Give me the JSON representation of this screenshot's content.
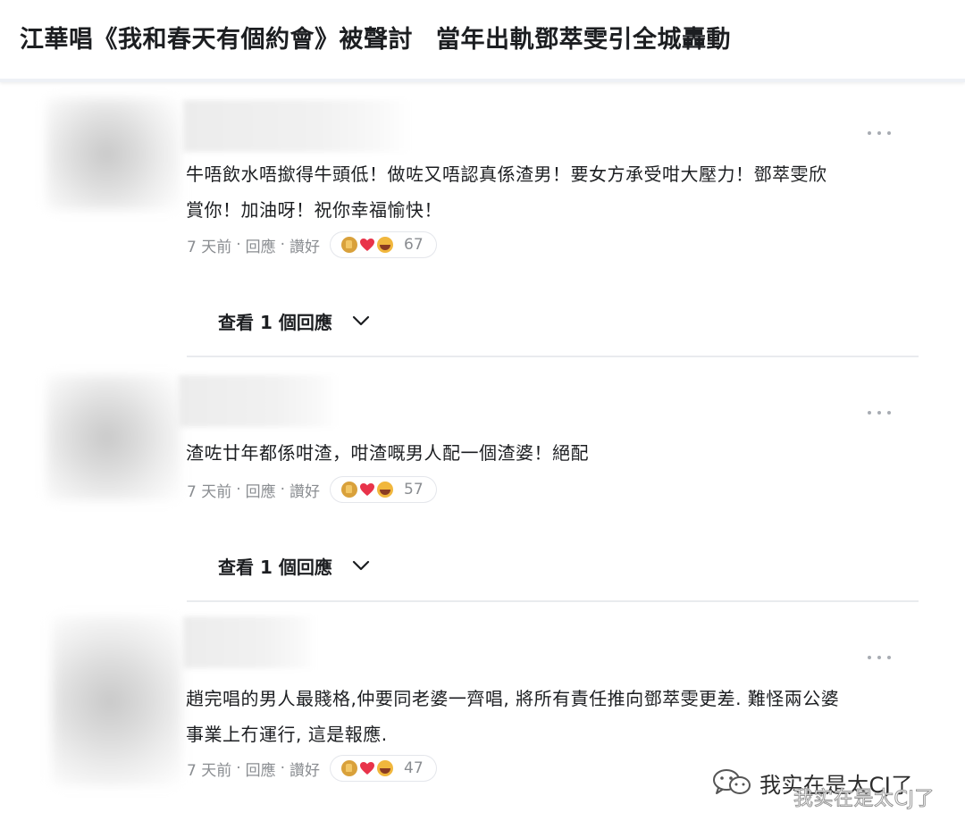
{
  "header": {
    "title_part1": "江華唱《我和春天有個約會》被聲討",
    "title_part2": "當年出軌鄧萃雯引全城轟動"
  },
  "comments": [
    {
      "body_line1": "牛唔飲水唔撳得牛頭低！做咗又唔認真係渣男！要女方承受咁大壓力！鄧萃雯欣",
      "body_line2": "賞你！加油呀！祝你幸福愉快！",
      "time": "7 天前",
      "reply_label": "回應",
      "like_label": "讚好",
      "reaction_count": "67",
      "reactions": [
        "like-icon",
        "love-icon",
        "haha-icon"
      ],
      "view_replies": "查看 1 個回應"
    },
    {
      "body_line1": "渣咗廿年都係咁渣，咁渣嘅男人配一個渣婆！絕配",
      "body_line2": "",
      "time": "7 天前",
      "reply_label": "回應",
      "like_label": "讚好",
      "reaction_count": "57",
      "reactions": [
        "like-icon",
        "love-icon",
        "haha-icon"
      ],
      "view_replies": "查看 1 個回應"
    },
    {
      "body_line1": "趙完唱的男人最賤格,仲要同老婆一齊唱, 將所有責任推向鄧萃雯更差. 難怪兩公婆",
      "body_line2": "事業上冇運行, 這是報應.",
      "time": "7 天前",
      "reply_label": "回應",
      "like_label": "讚好",
      "reaction_count": "47",
      "reactions": [
        "like-icon",
        "love-icon",
        "haha-icon"
      ]
    }
  ],
  "meta_separator": "·",
  "watermark": {
    "text": "我实在是太CJ了",
    "ghost_text": "我实在是太CJ了"
  },
  "colors": {
    "meta_gray": "#8a8d91",
    "divider": "#e9ebee",
    "love_red": "#e8334a"
  }
}
